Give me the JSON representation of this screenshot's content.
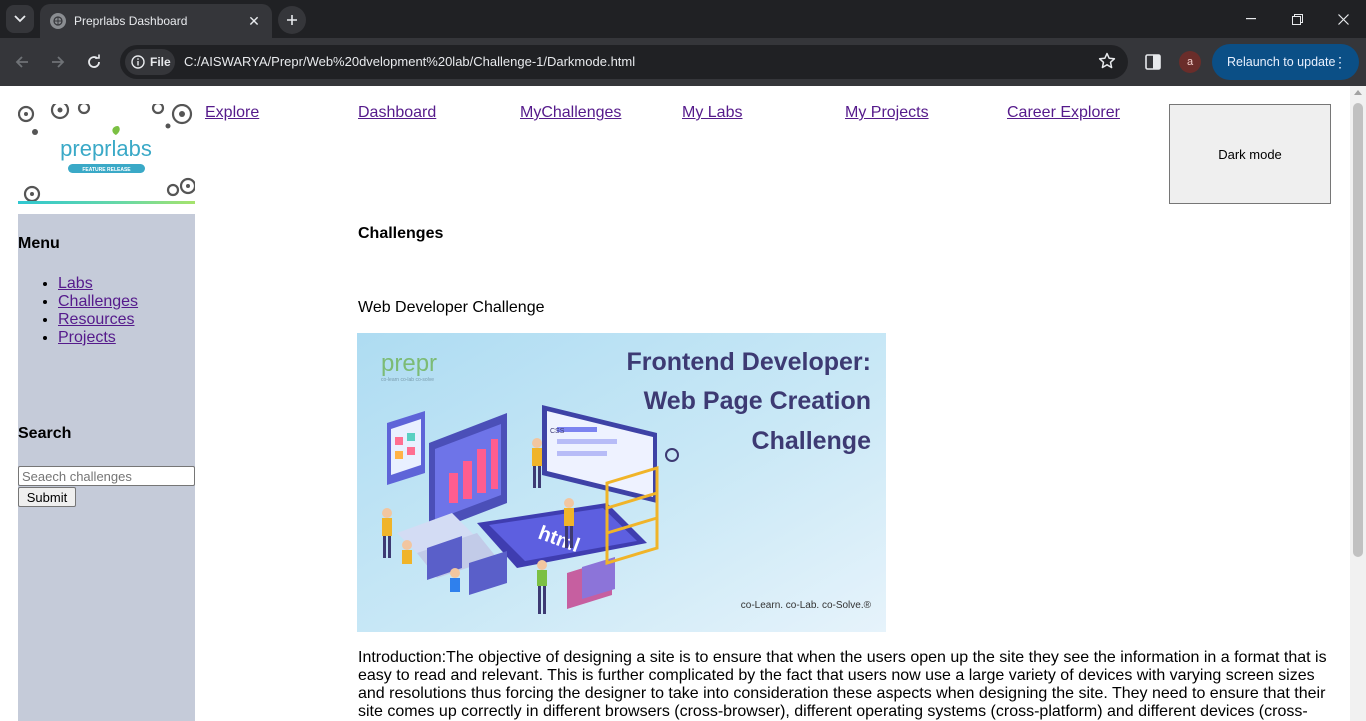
{
  "browser": {
    "tab_title": "Preprlabs Dashboard",
    "site_chip": "File",
    "url": "C:/AISWARYA/Prepr/Web%20dvelopment%20lab/Challenge-1/Darkmode.html",
    "profile_initial": "a",
    "relaunch_label": "Relaunch to update"
  },
  "logo": {
    "brand": "preprlabs",
    "tagline": "FEATURE RELEASE"
  },
  "nav": {
    "links": [
      "Explore",
      "Dashboard",
      "MyChallenges",
      "My Labs",
      "My Projects",
      "Career Explorer"
    ],
    "dark_mode_label": "Dark mode"
  },
  "sidebar": {
    "menu_title": "Menu",
    "items": [
      "Labs",
      "Challenges",
      "Resources",
      "Projects"
    ],
    "search_title": "Search",
    "search_placeholder": "Seaech challenges",
    "submit_label": "Submit"
  },
  "main": {
    "heading": "Challenges",
    "challenge_name": "Web Developer Challenge",
    "banner": {
      "brand": "prepr",
      "brand_sub": "co-learn co-lab co-solve",
      "title_lines": [
        "Frontend Developer:",
        "Web Page Creation",
        "Challenge"
      ],
      "html_tag": "html",
      "css_tag": "CSS",
      "tagline": "co-Learn. co-Lab. co-Solve.®"
    },
    "intro": "Introduction:The objective of designing a site is to ensure that when the users open up the site they see the information in a format that is easy to read and relevant. This is further complicated by the fact that users now use a large variety of devices with varying screen sizes and resolutions thus forcing the designer to take into consideration these aspects when designing the site. They need to ensure that their site comes up correctly in different browsers (cross-browser), different operating systems (cross-platform) and different devices (cross-"
  },
  "colors": {
    "link": "#551a8b",
    "sidebar_bg": "#c5cbd9",
    "banner_title": "#3d3a73",
    "relaunch_bg": "#0b4f86"
  }
}
